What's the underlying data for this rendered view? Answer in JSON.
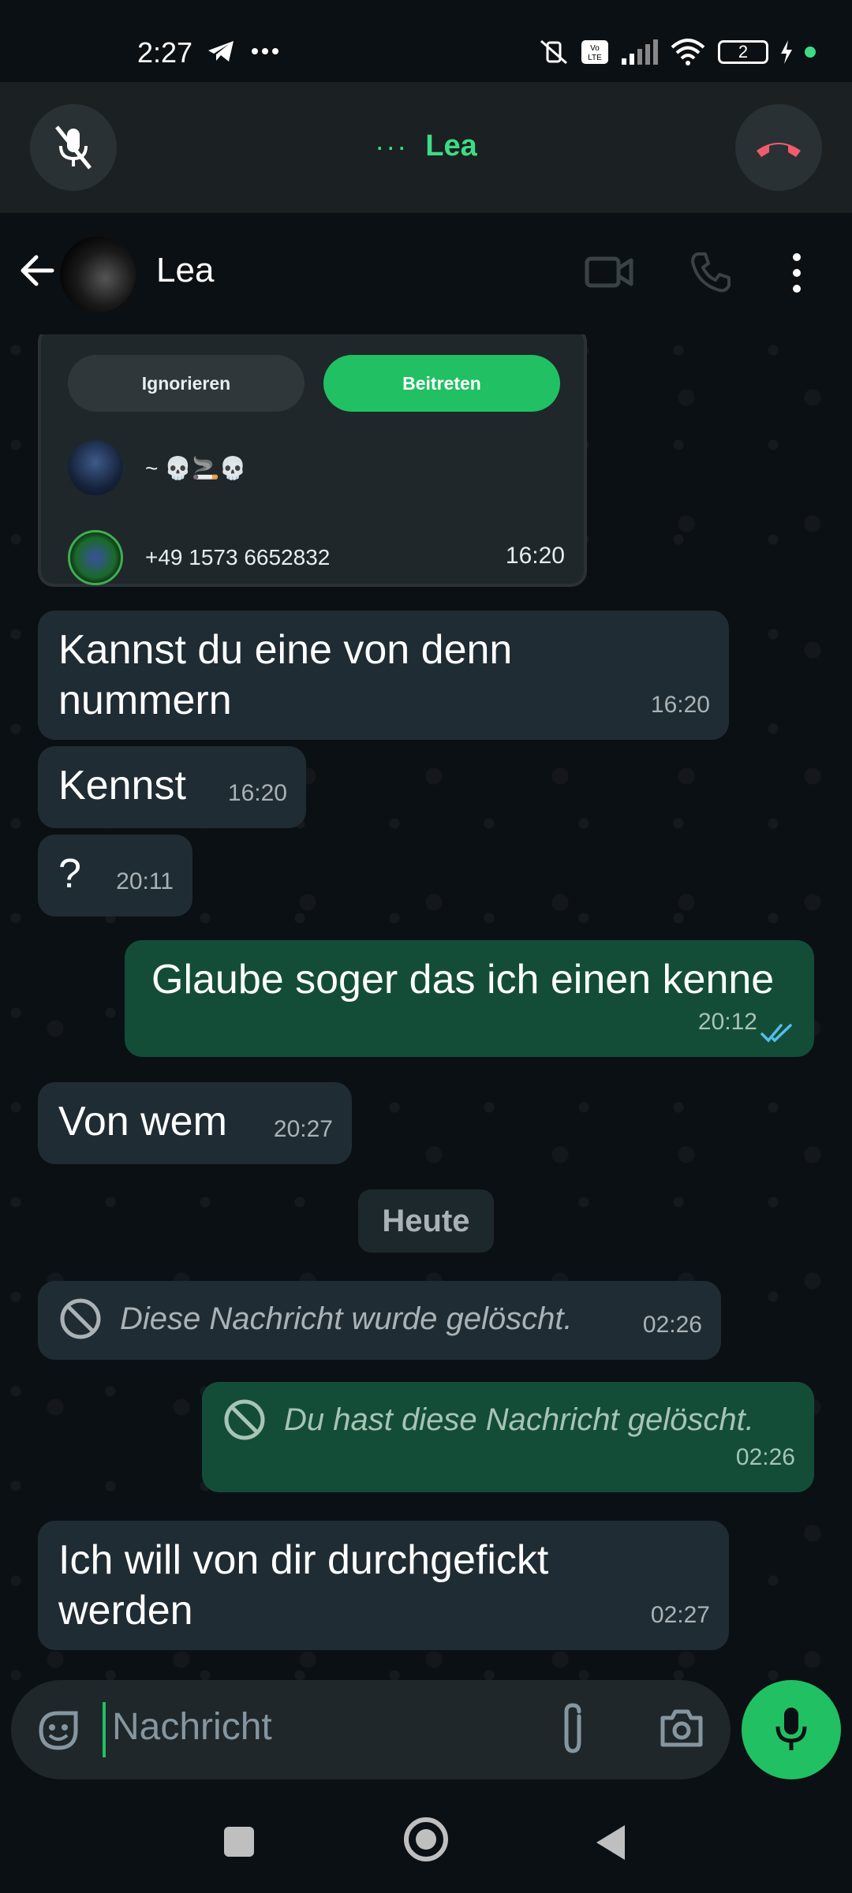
{
  "status_bar": {
    "time": "2:27",
    "battery": "2"
  },
  "call": {
    "dots": "···",
    "name": "Lea"
  },
  "header": {
    "name": "Lea"
  },
  "invite_card": {
    "ignore_label": "Ignorieren",
    "join_label": "Beitreten",
    "members": [
      {
        "name": "~ 💀🚬💀"
      },
      {
        "name": "+49 1573 6652832"
      }
    ],
    "time": "16:20"
  },
  "messages": [
    {
      "dir": "in",
      "text": "Kannst du eine von denn nummern",
      "time": "16:20"
    },
    {
      "dir": "in",
      "text": "Kennst",
      "time": "16:20"
    },
    {
      "dir": "in",
      "text": "?",
      "time": "20:11"
    },
    {
      "dir": "out",
      "text": "Glaube soger das ich einen kenne",
      "time": "20:12",
      "read": true
    },
    {
      "dir": "in",
      "text": "Von wem",
      "time": "20:27"
    },
    {
      "dir": "in",
      "text": "Diese Nachricht wurde gelöscht.",
      "time": "02:26",
      "deleted": true
    },
    {
      "dir": "out",
      "text": "Du hast diese Nachricht gelöscht.",
      "time": "02:26",
      "deleted": true
    },
    {
      "dir": "in",
      "text": "Ich will von dir durchgefickt werden",
      "time": "02:27"
    }
  ],
  "day_chip": "Heute",
  "input": {
    "placeholder": "Nachricht"
  },
  "colors": {
    "accent": "#21c063",
    "incoming": "#202c33",
    "outgoing": "#134d37",
    "end_call": "#f15c6d"
  },
  "icons": [
    "mic-off-icon",
    "end-call-icon",
    "back-arrow-icon",
    "video-call-icon",
    "voice-call-icon",
    "more-menu-icon",
    "sticker-icon",
    "attach-icon",
    "camera-icon",
    "mic-icon",
    "blocked-icon",
    "double-check-icon"
  ]
}
